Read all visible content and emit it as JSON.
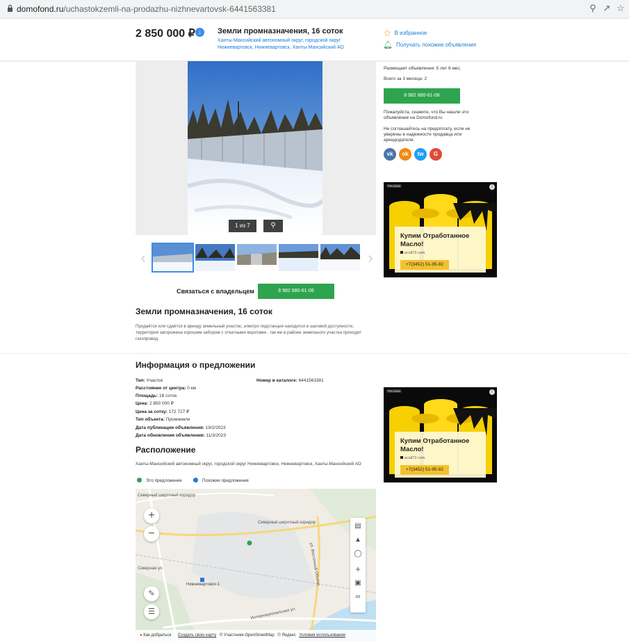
{
  "browser": {
    "url_host": "domofond.ru",
    "url_path": "/uchastokzemli-na-prodazhu-nizhnevartovsk-6441563381"
  },
  "header": {
    "price": "2 850 000 ₽",
    "title": "Земли промназначения, 16 соток",
    "address": "Ханты-Мансийский автономный округ, городской округ Нижневартовск, Нижневартовск, Ханты-Мансийский АО",
    "favorite": "В избранное",
    "similar": "Получать похожие объявления"
  },
  "gallery": {
    "counter": "1 из 7",
    "thumb_count": 5
  },
  "contact": {
    "label": "Связаться с владельцем",
    "phone": "8 982 880-61-08"
  },
  "listing": {
    "title": "Земли промназначения, 16 соток",
    "description": "Продаётся или сдаётся в аренду земельный участок, электро подстанция находится в шаговой доступности, территория загорожена хорошим забором с откатными воротами , так же в районе земельного участка проходит газопровод."
  },
  "info": {
    "title": "Информация о предложении",
    "rows": [
      {
        "label": "Тип:",
        "value": "Участок"
      },
      {
        "label": "Расстояние от центра:",
        "value": "0 км"
      },
      {
        "label": "Площадь:",
        "value": "16 соток"
      },
      {
        "label": "Цена:",
        "value": "2 850 000 ₽"
      },
      {
        "label": "Цена за сотку:",
        "value": "172 727 ₽"
      },
      {
        "label": "Тип объекта:",
        "value": "Промземли"
      },
      {
        "label": "Дата публикации объявления:",
        "value": "19/2/2023"
      },
      {
        "label": "Дата обновления объявления:",
        "value": "11/3/2023"
      }
    ],
    "catalog_label": "Номер в каталоге:",
    "catalog_value": "6441563381"
  },
  "location": {
    "title": "Расположение",
    "address": "Ханты-Мансийский автономный округ, городской округ Нижневартовск, Нижневартовск, Ханты-Мансийский АО",
    "legend_this": "Это предложение",
    "legend_similar": "Похожие предложения",
    "colors": {
      "this": "#2ea44f",
      "similar": "#1a7ed8"
    }
  },
  "map": {
    "labels": {
      "road1": "Северный широтный коридор",
      "road2": "Северный широтный коридор",
      "station": "Нижневартовск-1",
      "road3": "ул. Восточный Объезд",
      "road4": "Интернациональная ул.",
      "road5": "Северная ул."
    },
    "footer": {
      "route": "Как добраться",
      "create": "Создать свою карту",
      "osm": "© Участники OpenStreetMap",
      "yandex": "© Яндекс",
      "terms": "Условия использования"
    }
  },
  "sidebar": {
    "experience": "Размещает объявления: 5 лет 6 мес.",
    "last3": "Всего за 3 месяца: 2",
    "phone": "8 982 880-61-08",
    "note1": "Пожалуйста, скажите, что Вы нашли это объявление на Domofond.ru",
    "note2": "Не соглашайтесь на предоплату, если не уверены в надежности продавца или арендодателя.",
    "socials": [
      "vk",
      "ok",
      "tw",
      "G"
    ]
  },
  "ad": {
    "tag": "Реклама",
    "title": "Купим Отработанное Масло!",
    "site": "ecoil72.com",
    "phone": "+7(3452) 51-95-92"
  }
}
